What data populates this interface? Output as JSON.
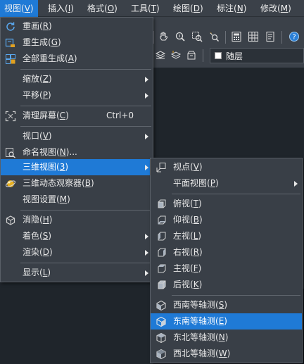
{
  "menubar": {
    "items": [
      {
        "label": "视图",
        "key": "V"
      },
      {
        "label": "插入",
        "key": "I"
      },
      {
        "label": "格式",
        "key": "O"
      },
      {
        "label": "工具",
        "key": "T"
      },
      {
        "label": "绘图",
        "key": "D"
      },
      {
        "label": "标注",
        "key": "N"
      },
      {
        "label": "修改",
        "key": "M"
      }
    ]
  },
  "toolbar": {
    "layer_name": "随层"
  },
  "view_menu": {
    "items": [
      {
        "label": "重画",
        "key": "R",
        "icon": "redraw-icon"
      },
      {
        "label": "重生成",
        "key": "G",
        "icon": "regen-icon"
      },
      {
        "label": "全部重生成",
        "key": "A",
        "icon": "regen-all-icon"
      },
      {
        "label": "缩放",
        "key": "Z"
      },
      {
        "label": "平移",
        "key": "P"
      },
      {
        "label": "清理屏幕",
        "key": "C",
        "shortcut": "Ctrl+0",
        "icon": "clean-screen-icon"
      },
      {
        "label": "视口",
        "key": "V"
      },
      {
        "label": "命名视图",
        "key": "N",
        "suffix": "...",
        "icon": "named-view-icon"
      },
      {
        "label": "三维视图",
        "key": "3"
      },
      {
        "label": "三维动态观察器",
        "key": "B",
        "icon": "orbit-icon"
      },
      {
        "label": "视图设置",
        "key": "M"
      },
      {
        "label": "消隐",
        "key": "H",
        "icon": "hide-icon"
      },
      {
        "label": "着色",
        "key": "S"
      },
      {
        "label": "渲染",
        "key": "D"
      },
      {
        "label": "显示",
        "key": "L"
      }
    ]
  },
  "view3d_menu": {
    "items": [
      {
        "label": "视点",
        "key": "V",
        "icon": "viewpoint-icon"
      },
      {
        "label": "平面视图",
        "key": "P"
      },
      {
        "label": "俯视",
        "key": "T",
        "icon": "top-view-icon"
      },
      {
        "label": "仰视",
        "key": "B",
        "icon": "bottom-view-icon"
      },
      {
        "label": "左视",
        "key": "L",
        "icon": "left-view-icon"
      },
      {
        "label": "右视",
        "key": "R",
        "icon": "right-view-icon"
      },
      {
        "label": "主视",
        "key": "F",
        "icon": "front-view-icon"
      },
      {
        "label": "后视",
        "key": "K",
        "icon": "back-view-icon"
      },
      {
        "label": "西南等轴测",
        "key": "S",
        "icon": "sw-iso-icon"
      },
      {
        "label": "东南等轴测",
        "key": "E",
        "icon": "se-iso-icon"
      },
      {
        "label": "东北等轴测",
        "key": "N",
        "icon": "ne-iso-icon"
      },
      {
        "label": "西北等轴测",
        "key": "W",
        "icon": "nw-iso-icon"
      }
    ]
  },
  "colors": {
    "highlight": "#1f7ad6",
    "menu_bg": "#393f47",
    "menubar_bg": "#3b4149"
  }
}
